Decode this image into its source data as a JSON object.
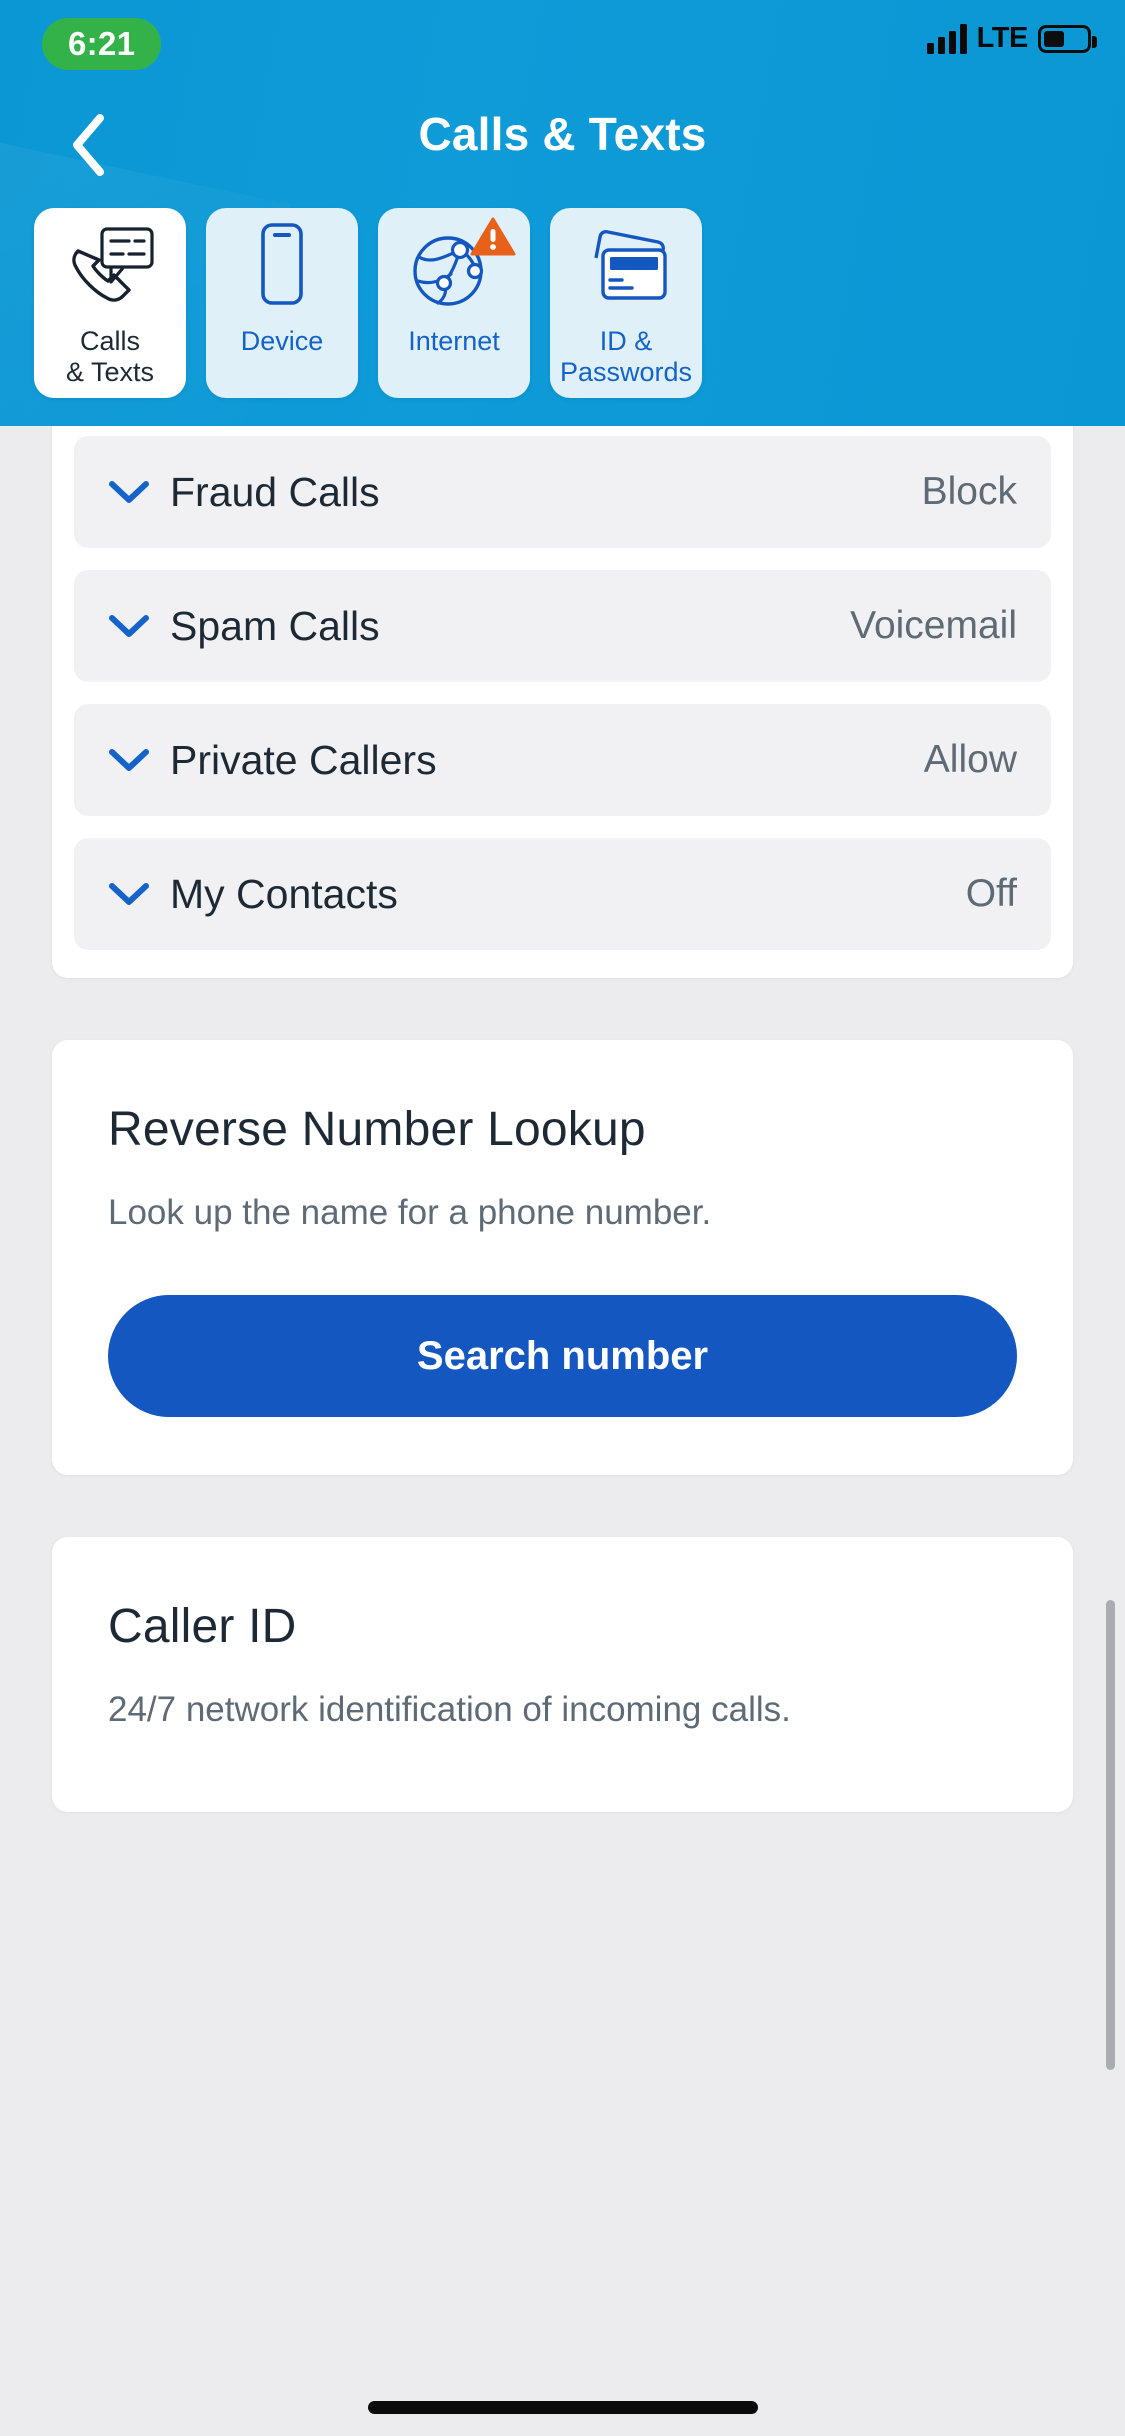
{
  "status_bar": {
    "time": "6:21",
    "network_label": "LTE",
    "signal_icon": "cellular-signal-icon",
    "battery_icon": "battery-icon",
    "recording_pill_color": "#34b24a"
  },
  "header": {
    "title": "Calls & Texts",
    "back_icon": "chevron-left-icon",
    "background_color": "#0b97d4"
  },
  "tabs": [
    {
      "label_line1": "Calls",
      "label_line2": "& Texts",
      "icon": "phone-message-icon",
      "active": true,
      "warning": false
    },
    {
      "label_line1": "Device",
      "label_line2": "",
      "icon": "smartphone-icon",
      "active": false,
      "warning": false
    },
    {
      "label_line1": "Internet",
      "label_line2": "",
      "icon": "network-globe-icon",
      "active": false,
      "warning": true
    },
    {
      "label_line1": "ID &",
      "label_line2": "Passwords",
      "icon": "id-cards-icon",
      "active": false,
      "warning": false
    }
  ],
  "settings_rows": [
    {
      "label": "Fraud Calls",
      "value": "Block",
      "chevron": "chevron-down-icon"
    },
    {
      "label": "Spam Calls",
      "value": "Voicemail",
      "chevron": "chevron-down-icon"
    },
    {
      "label": "Private Callers",
      "value": "Allow",
      "chevron": "chevron-down-icon"
    },
    {
      "label": "My Contacts",
      "value": "Off",
      "chevron": "chevron-down-icon"
    }
  ],
  "reverse_lookup_card": {
    "title": "Reverse Number Lookup",
    "subtitle": "Look up the name for a phone number.",
    "button_label": "Search number",
    "button_color": "#1457c0"
  },
  "caller_id_card": {
    "title": "Caller ID",
    "subtitle": "24/7 network identification of incoming calls."
  },
  "colors": {
    "header_blue": "#0b97d4",
    "tab_inactive": "#dff0f8",
    "link_blue": "#1463c8",
    "warning_orange": "#e8611b",
    "row_bg": "#f1f1f3",
    "text_dark": "#1d2a36",
    "text_muted": "#5e6b77"
  }
}
